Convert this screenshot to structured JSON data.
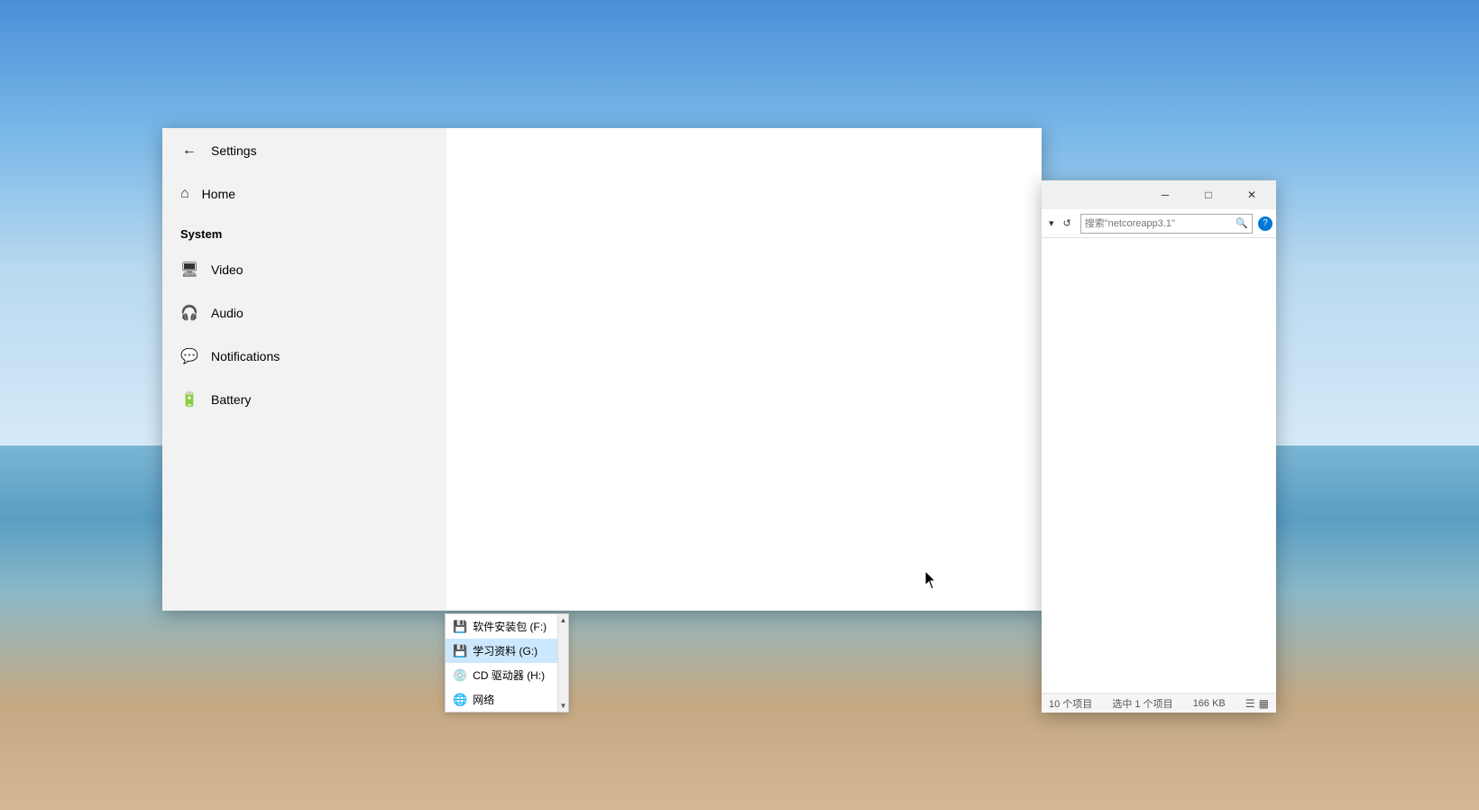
{
  "desktop": {
    "background": "sky-beach scene"
  },
  "settings_window": {
    "title": "Settings",
    "back_label": "←",
    "home_label": "Home",
    "system_label": "System",
    "nav_items": [
      {
        "id": "video",
        "label": "Video",
        "icon": "🖥"
      },
      {
        "id": "audio",
        "label": "Audio",
        "icon": "🎧"
      },
      {
        "id": "notifications",
        "label": "Notifications",
        "icon": "💬"
      },
      {
        "id": "battery",
        "label": "Battery",
        "icon": "🔋"
      }
    ]
  },
  "explorer_window": {
    "title": "",
    "search_placeholder": "搜索\"netcoreapp3.1\"",
    "minimize_label": "─",
    "restore_label": "□",
    "close_label": "✕",
    "status": {
      "items_count": "10 个项目",
      "selected_info": "选中 1 个项目",
      "size": "166 KB"
    }
  },
  "dropdown_panel": {
    "items": [
      {
        "id": "software",
        "label": "软件安装包 (F:)",
        "icon": "💾",
        "selected": false
      },
      {
        "id": "study",
        "label": "学习资料 (G:)",
        "icon": "💾",
        "selected": true
      },
      {
        "id": "cd",
        "label": "CD 驱动器 (H:)",
        "icon": "💿",
        "selected": false
      },
      {
        "id": "network",
        "label": "网络",
        "icon": "🌐",
        "selected": false
      }
    ]
  }
}
